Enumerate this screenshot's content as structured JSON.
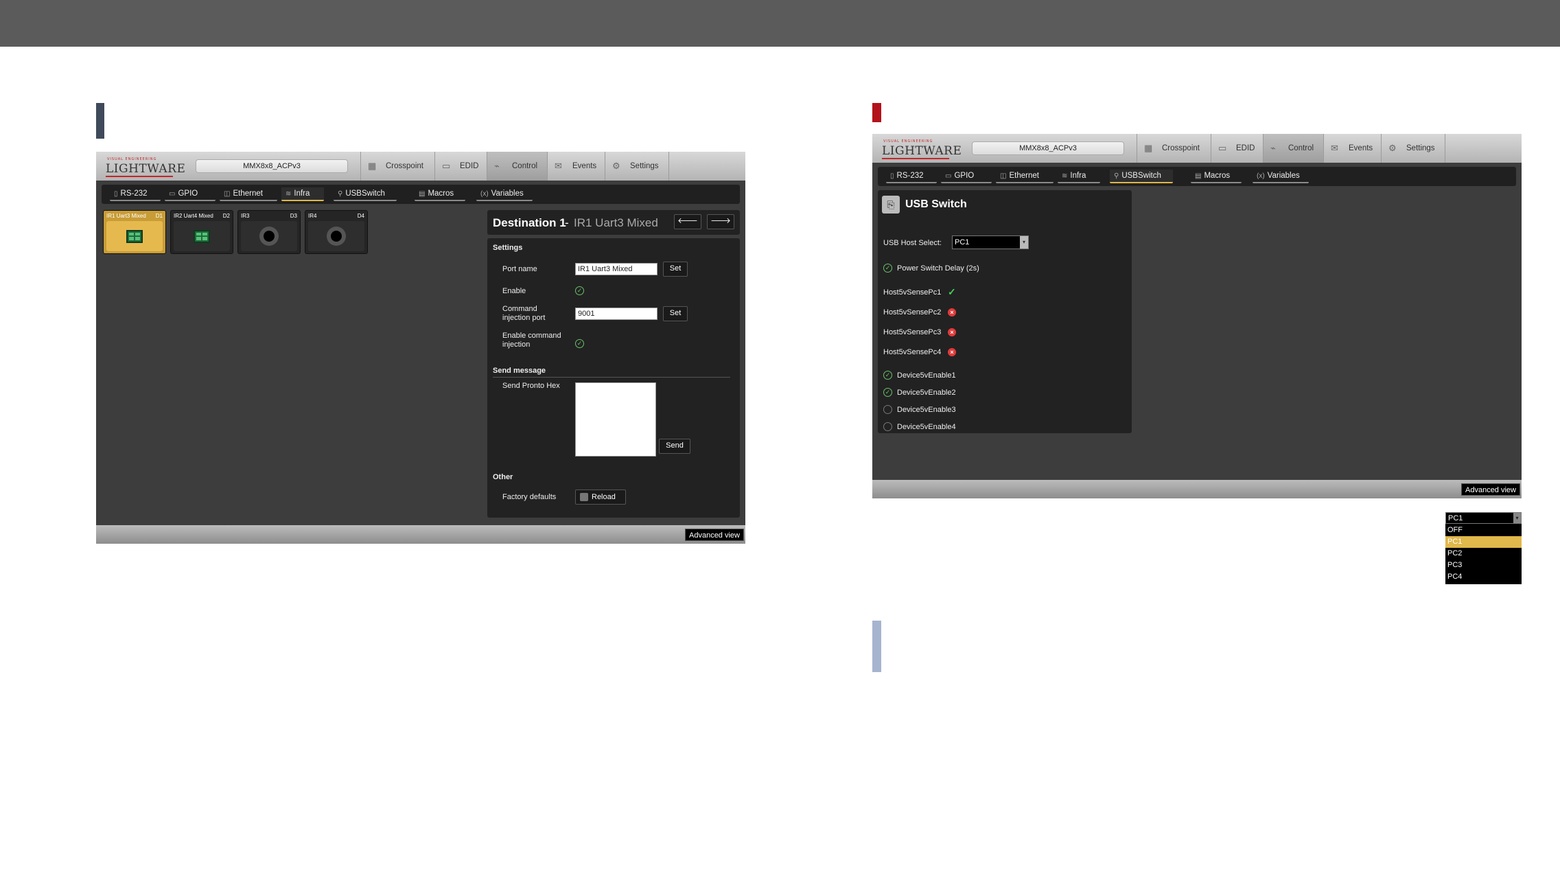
{
  "left_app": {
    "logo": {
      "tagline": "VISUAL ENGINEERING",
      "name": "LIGHTWARE"
    },
    "device_name": "MMX8x8_ACPv3",
    "main_tabs": [
      {
        "label": "Crosspoint",
        "icon": "crosspoint-grid-icon"
      },
      {
        "label": "EDID",
        "icon": "monitor-icon"
      },
      {
        "label": "Control",
        "icon": "control-icon",
        "active": true
      },
      {
        "label": "Events",
        "icon": "events-icon"
      },
      {
        "label": "Settings",
        "icon": "gears-icon"
      }
    ],
    "sub_tabs": [
      {
        "label": "RS-232"
      },
      {
        "label": "GPIO"
      },
      {
        "label": "Ethernet"
      },
      {
        "label": "Infra",
        "active": true
      },
      {
        "label": "USBSwitch"
      },
      {
        "label": "Macros"
      },
      {
        "label": "Variables"
      }
    ],
    "ports": [
      {
        "label": "IR1 Uart3 Mixed",
        "num": "D1"
      },
      {
        "label": "IR2 Uart4 Mixed",
        "num": "D2"
      },
      {
        "label": "IR3",
        "num": "D3"
      },
      {
        "label": "IR4",
        "num": "D4"
      }
    ],
    "destination": {
      "title": "Destination 1",
      "subtitle": "IR1 Uart3 Mixed",
      "prev_icon": "arrow-left-icon",
      "next_icon": "arrow-right-icon",
      "settings_heading": "Settings",
      "port_name_label": "Port name",
      "port_name_value": "IR1 Uart3 Mixed",
      "set_label": "Set",
      "enable_label": "Enable",
      "cmd_port_label_1": "Command",
      "cmd_port_label_2": "injection port",
      "cmd_port_value": "9001",
      "enable_cmd_label_1": "Enable command",
      "enable_cmd_label_2": "injection",
      "send_message_heading": "Send message",
      "send_pronto_label": "Send Pronto Hex",
      "send_label": "Send",
      "other_heading": "Other",
      "factory_defaults_label": "Factory defaults",
      "reload_label": "Reload"
    },
    "advanced_view": "Advanced view"
  },
  "right_app": {
    "logo": {
      "tagline": "VISUAL ENGINEERING",
      "name": "LIGHTWARE"
    },
    "device_name": "MMX8x8_ACPv3",
    "main_tabs": [
      {
        "label": "Crosspoint"
      },
      {
        "label": "EDID"
      },
      {
        "label": "Control",
        "active": true
      },
      {
        "label": "Events"
      },
      {
        "label": "Settings"
      }
    ],
    "sub_tabs": [
      {
        "label": "RS-232"
      },
      {
        "label": "GPIO"
      },
      {
        "label": "Ethernet"
      },
      {
        "label": "Infra"
      },
      {
        "label": "USBSwitch",
        "active": true
      },
      {
        "label": "Macros"
      },
      {
        "label": "Variables"
      }
    ],
    "usb_switch": {
      "title": "USB Switch",
      "host_select_label": "USB Host Select:",
      "host_select_value": "PC1",
      "power_switch_delay": "Power Switch Delay (2s)",
      "sense": [
        {
          "label": "Host5vSensePc1",
          "state": "ok"
        },
        {
          "label": "Host5vSensePc2",
          "state": "error"
        },
        {
          "label": "Host5vSensePc3",
          "state": "error"
        },
        {
          "label": "Host5vSensePc4",
          "state": "error"
        }
      ],
      "enables": [
        {
          "label": "Device5vEnable1",
          "checked": true
        },
        {
          "label": "Device5vEnable2",
          "checked": true
        },
        {
          "label": "Device5vEnable3",
          "checked": false
        },
        {
          "label": "Device5vEnable4",
          "checked": false
        }
      ]
    },
    "advanced_view": "Advanced view"
  },
  "dropdown": {
    "selected": "PC1",
    "options": [
      "OFF",
      "PC1",
      "PC2",
      "PC3",
      "PC4"
    ],
    "highlighted": "PC1"
  },
  "colors": {
    "top_bar": "#5b5b5c",
    "left_marker": "#3f4a5a",
    "right_marker": "#b3121b",
    "bottom_marker": "#a7b4d0",
    "highlight": "#e0b84b"
  }
}
